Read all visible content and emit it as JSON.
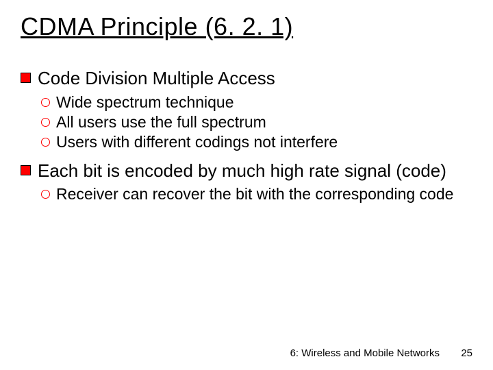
{
  "title": "CDMA Principle (6. 2. 1)",
  "bullets": {
    "b1": "Code Division Multiple Access",
    "b1_1": "Wide spectrum technique",
    "b1_2": "All users use the full spectrum",
    "b1_3": "Users with different codings not interfere",
    "b2": "Each bit is encoded by much high rate signal (code)",
    "b2_1": "Receiver can recover the bit with the corresponding code"
  },
  "footer": {
    "section": "6: Wireless and Mobile Networks",
    "page": "25"
  }
}
